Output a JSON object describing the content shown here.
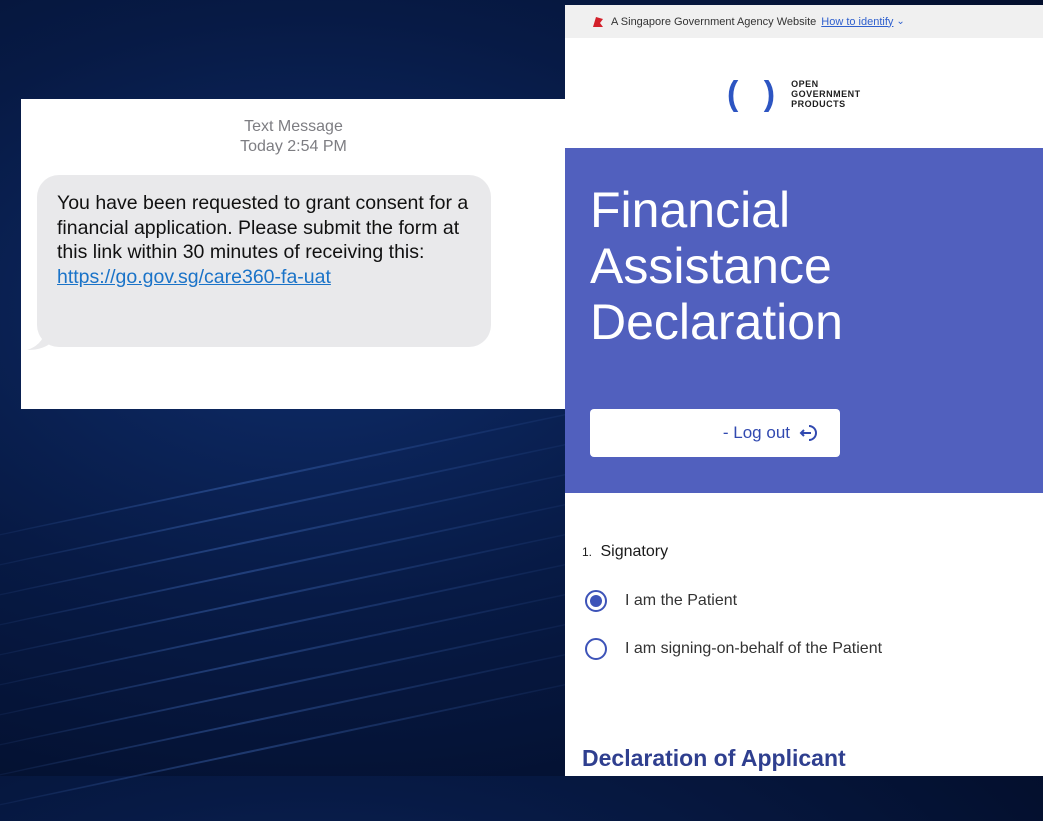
{
  "sms": {
    "header_line1": "Text Message",
    "header_line2": "Today 2:54 PM",
    "body_text": "You have been requested to grant consent for a financial application. Please submit the form at this link within 30 minutes of receiving this: ",
    "link_text": "https://go.gov.sg/care360-fa-uat"
  },
  "web": {
    "masthead": {
      "text": "A Singapore Government Agency Website",
      "how_to_identify": "How to identify",
      "icon": "lion-head-icon"
    },
    "logo": {
      "line1": "OPEN",
      "line2": "GOVERNMENT",
      "line3": "PRODUCTS"
    },
    "hero": {
      "title": "Financial Assistance Declaration",
      "logout_label": "- Log out",
      "logout_icon": "logout-icon"
    },
    "question": {
      "number": "1.",
      "label": "Signatory",
      "options": [
        {
          "label": "I am the Patient",
          "selected": true
        },
        {
          "label": "I am signing-on-behalf of the Patient",
          "selected": false
        }
      ]
    },
    "section_title": "Declaration of Applicant"
  },
  "colors": {
    "hero_bg": "#5160be",
    "accent": "#3d53b8",
    "link": "#1a73c8",
    "background": "#071a45"
  }
}
